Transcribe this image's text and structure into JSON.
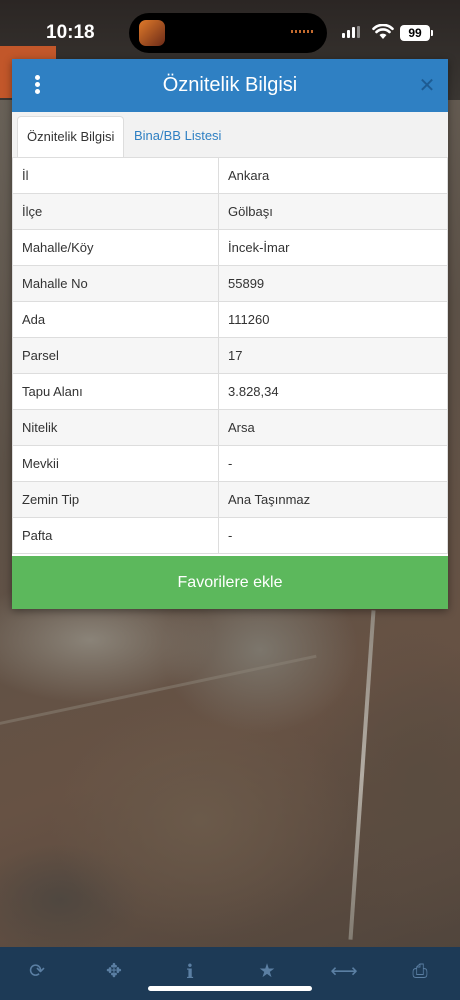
{
  "status_bar": {
    "time": "10:18",
    "battery": "99"
  },
  "panel": {
    "title": "Öznitelik Bilgisi",
    "close_glyph": "✕",
    "tabs": [
      {
        "label": "Öznitelik Bilgisi",
        "active": true
      },
      {
        "label": "Bina/BB Listesi",
        "active": false
      }
    ],
    "rows": [
      {
        "key": "İl",
        "value": "Ankara"
      },
      {
        "key": "İlçe",
        "value": "Gölbaşı"
      },
      {
        "key": "Mahalle/Köy",
        "value": "İncek-İmar"
      },
      {
        "key": "Mahalle No",
        "value": "55899"
      },
      {
        "key": "Ada",
        "value": "111260"
      },
      {
        "key": "Parsel",
        "value": "17"
      },
      {
        "key": "Tapu Alanı",
        "value": "3.828,34"
      },
      {
        "key": "Nitelik",
        "value": "Arsa"
      },
      {
        "key": "Mevkii",
        "value": "-"
      },
      {
        "key": "Zemin Tip",
        "value": "Ana Taşınmaz"
      },
      {
        "key": "Pafta",
        "value": "-"
      }
    ],
    "favorite_button": "Favorilere ekle"
  },
  "toolbar": {
    "items": [
      {
        "icon": "refresh-icon",
        "glyph": "⟳"
      },
      {
        "icon": "crosshair-icon",
        "glyph": "✥"
      },
      {
        "icon": "info-icon",
        "glyph": "i"
      },
      {
        "icon": "star-icon",
        "glyph": "★"
      },
      {
        "icon": "measure-icon",
        "glyph": "⟷"
      },
      {
        "icon": "print-icon",
        "glyph": "⎙"
      }
    ]
  },
  "colors": {
    "header": "#2f80c3",
    "favorite_button": "#5cb85c",
    "toolbar": "#1d3a56",
    "toolbar_icon": "#5b7fa3"
  }
}
